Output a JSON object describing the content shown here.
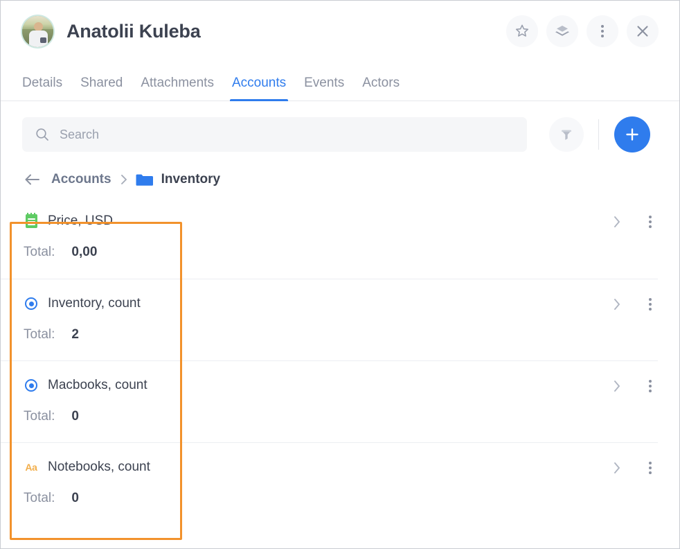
{
  "header": {
    "title": "Anatolii Kuleba",
    "avatar_name": "user-avatar-photo",
    "actions": [
      {
        "name": "favorite-star-button",
        "icon": "star-icon"
      },
      {
        "name": "layers-button",
        "icon": "layers-icon"
      },
      {
        "name": "more-options-button",
        "icon": "vertical-dots-icon"
      },
      {
        "name": "close-button",
        "icon": "close-x-icon"
      }
    ]
  },
  "tabs": [
    {
      "label": "Details",
      "active": false
    },
    {
      "label": "Shared",
      "active": false
    },
    {
      "label": "Attachments",
      "active": false
    },
    {
      "label": "Accounts",
      "active": true
    },
    {
      "label": "Events",
      "active": false
    },
    {
      "label": "Actors",
      "active": false
    }
  ],
  "search": {
    "value": "",
    "placeholder": "Search",
    "icon": "search-icon"
  },
  "toolbar": {
    "filter_icon": "filter-funnel-icon",
    "add_icon": "plus-icon"
  },
  "breadcrumb": {
    "back_icon": "arrow-left-icon",
    "root_label": "Accounts",
    "separator": "chevron-right-icon",
    "folder_icon": "folder-icon",
    "current_label": "Inventory"
  },
  "list": {
    "total_label": "Total:",
    "row_chevron_icon": "chevron-right-icon",
    "row_menu_icon": "vertical-dots-icon",
    "rows": [
      {
        "icon": "green-notepad-icon",
        "icon_type": "note",
        "title": "Price, USD",
        "total": "0,00"
      },
      {
        "icon": "blue-radio-dot-icon",
        "icon_type": "radio",
        "title": "Inventory, count",
        "total": "2"
      },
      {
        "icon": "blue-radio-dot-icon",
        "icon_type": "radio",
        "title": "Macbooks, count",
        "total": "0"
      },
      {
        "icon": "orange-aa-text-icon",
        "icon_type": "aa",
        "title": "Notebooks, count",
        "total": "0"
      }
    ]
  },
  "annotation": {
    "highlight_color": "#f2922c"
  },
  "colors": {
    "accent_blue": "#2f7ced",
    "text_dark": "#3c4250",
    "text_muted": "#8b91a0",
    "green": "#5ecb63",
    "orange": "#f2ae4b",
    "highlight": "#f2922c"
  }
}
